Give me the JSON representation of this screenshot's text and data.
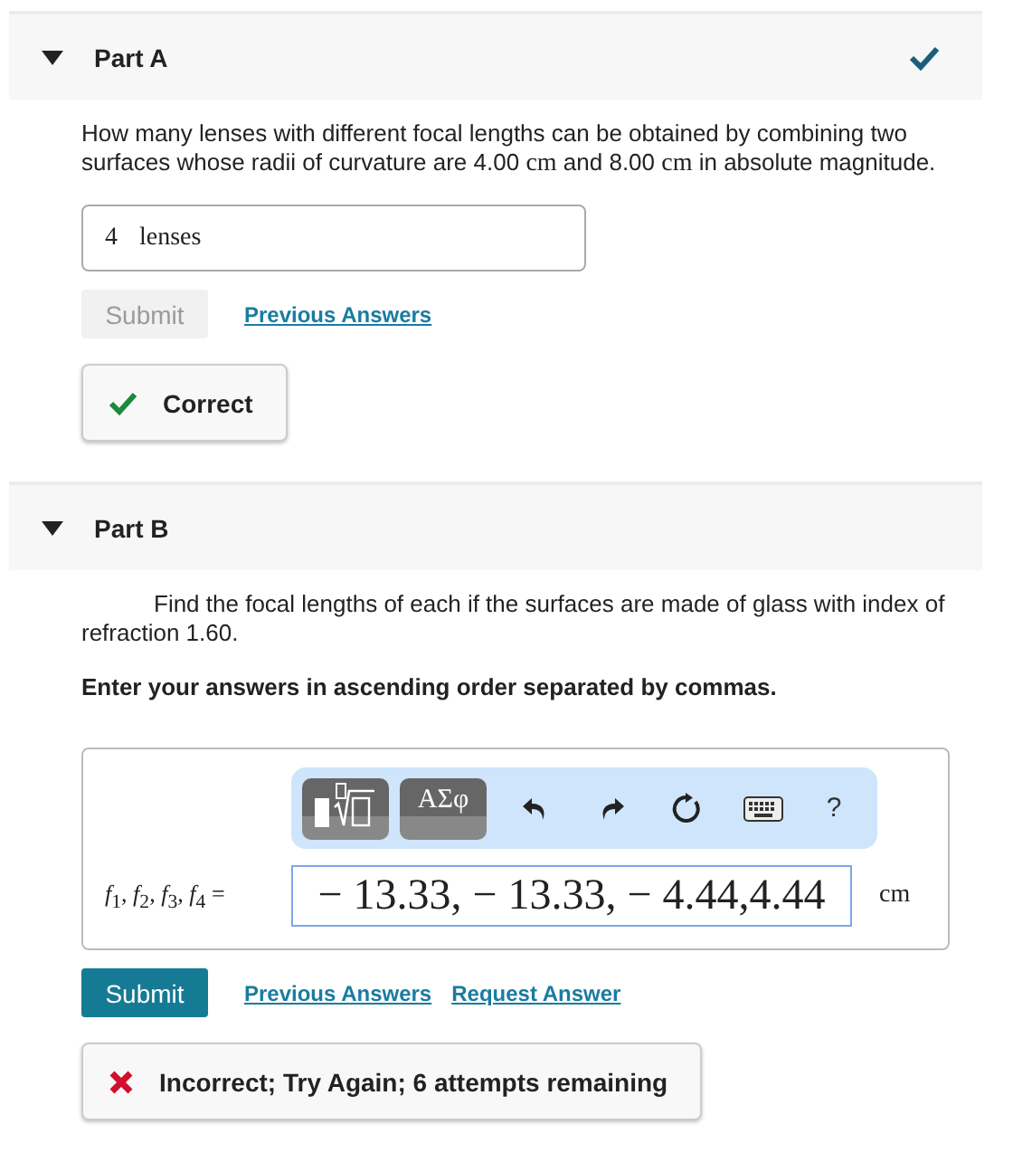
{
  "parts": [
    {
      "title": "Part A",
      "expanded": true,
      "completed": true,
      "question": [
        {
          "kind": "text",
          "text": "How many lenses with different focal lengths can be obtained by combining two surfaces whose radii of curvature are 4.00 "
        },
        {
          "kind": "math",
          "text": "cm"
        },
        {
          "kind": "text",
          "text": " and 8.00 "
        },
        {
          "kind": "math",
          "text": "cm"
        },
        {
          "kind": "text",
          "text": " in absolute magnitude."
        }
      ],
      "answer": {
        "kind": "simple",
        "value": "4",
        "unit": "lenses"
      },
      "submit": {
        "label": "Submit",
        "disabled": true
      },
      "links": [
        "Previous Answers"
      ],
      "feedback": {
        "kind": "correct",
        "text": "Correct"
      }
    },
    {
      "title": "Part B",
      "expanded": true,
      "completed": false,
      "question": [
        {
          "kind": "text",
          "text": "Find the focal lengths of each if the surfaces are made of glass with index of refraction 1.60."
        }
      ],
      "instruction": "Enter your answers in ascending order separated by commas.",
      "answer": {
        "kind": "editor",
        "label": "*f*$_{1}$, *f*$_{2}$, *f*$_{3}$, *f*$_{4}$ =",
        "value": "− 13.33, − 13.33, − 4.44,4.44",
        "unit": "cm",
        "toolbar": [
          {
            "kind": "templates"
          },
          {
            "kind": "symbols",
            "label": "ΑΣφ"
          },
          {
            "kind": "undo"
          },
          {
            "kind": "redo"
          },
          {
            "kind": "reset"
          },
          {
            "kind": "keyboard"
          },
          {
            "kind": "help",
            "label": "?"
          }
        ]
      },
      "submit": {
        "label": "Submit",
        "disabled": false
      },
      "links": [
        "Previous Answers",
        "Request Answer"
      ],
      "feedback": {
        "kind": "incorrect",
        "text": "Incorrect; Try Again; 6 attempts remaining"
      }
    }
  ]
}
